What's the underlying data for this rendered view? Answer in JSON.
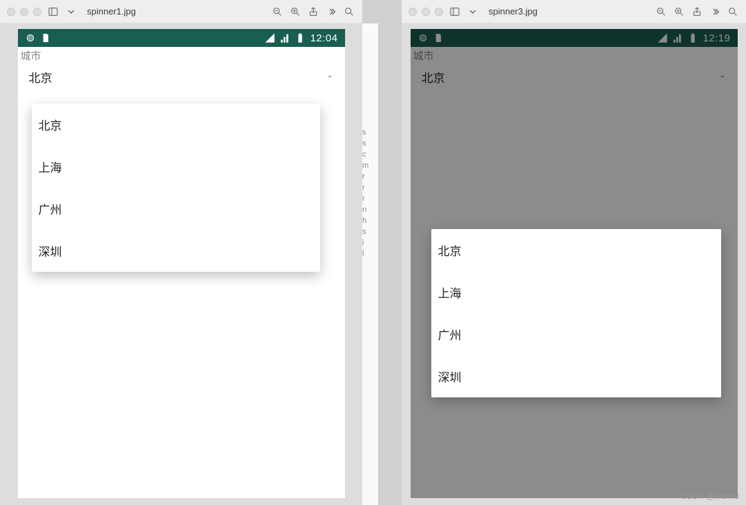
{
  "window_left": {
    "filename": "spinner1.jpg",
    "statusbar_time": "12:04",
    "label": "城市",
    "spinner_selected": "北京",
    "dropdown_items": [
      "北京",
      "上海",
      "广州",
      "深圳"
    ]
  },
  "window_right": {
    "filename": "spinner3.jpg",
    "statusbar_time": "12:19",
    "label": "城市",
    "spinner_selected": "北京",
    "dialog_items": [
      "北京",
      "上海",
      "广州",
      "深圳"
    ]
  },
  "between_text": "s\ns\nc\nm\nr\nr\nr\nn\nh\ns\ni\nl",
  "watermark": "CSDN @liranke"
}
